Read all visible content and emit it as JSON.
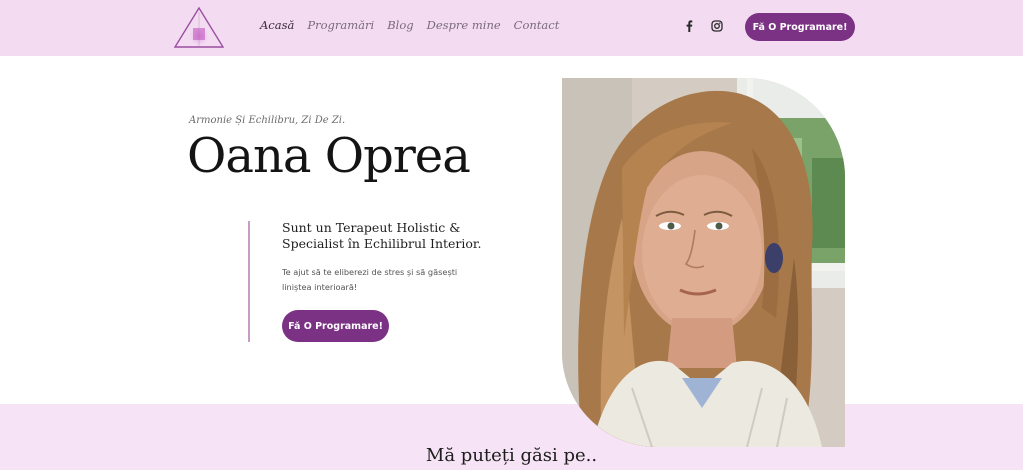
{
  "header": {
    "nav": [
      {
        "label": "Acasă",
        "active": true
      },
      {
        "label": "Programări",
        "active": false
      },
      {
        "label": "Blog",
        "active": false
      },
      {
        "label": "Despre mine",
        "active": false
      },
      {
        "label": "Contact",
        "active": false
      }
    ],
    "social_icons": [
      "facebook-icon",
      "instagram-icon"
    ],
    "cta_label": "Fă O Programare!"
  },
  "hero": {
    "tagline": "Armonie Și Echilibru, Zi De Zi.",
    "name": "Oana Oprea",
    "subheading_lines": [
      "Sunt un Terapeut Holistic &",
      "Specialist în Echilibrul Interior."
    ],
    "description_lines": [
      "Te ajut să te eliberezi de stres și să găsești",
      "liniștea interioară!"
    ],
    "cta_label": "Fă O Programare!"
  },
  "section": {
    "heading": "Mă puteți găsi pe.."
  },
  "colors": {
    "header_bg": "#f3dcf2",
    "accent": "#7b3284",
    "band_bg": "#f6e3f5"
  }
}
